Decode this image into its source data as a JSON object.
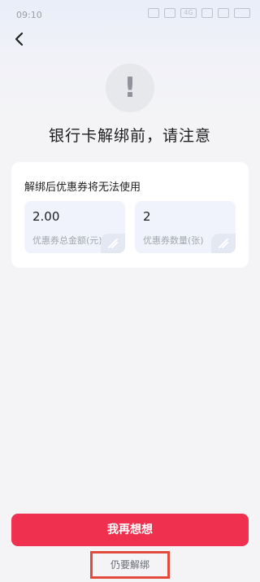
{
  "status_bar": {
    "time": "09:10",
    "network_label": "4G"
  },
  "nav": {
    "back_icon": "chevron-left-icon"
  },
  "alert": {
    "icon": "exclamation-icon",
    "icon_glyph": "!",
    "title": "银行卡解绑前，请注意"
  },
  "notice_card": {
    "title": "解绑后优惠券将无法使用",
    "stats": [
      {
        "value": "2.00",
        "label": "优惠券总金额(元)"
      },
      {
        "value": "2",
        "label": "优惠券数量(张)"
      }
    ]
  },
  "actions": {
    "primary_label": "我再想想",
    "secondary_label": "仍要解绑"
  },
  "colors": {
    "accent": "#f0304f",
    "highlight_border": "#e24b3b"
  }
}
